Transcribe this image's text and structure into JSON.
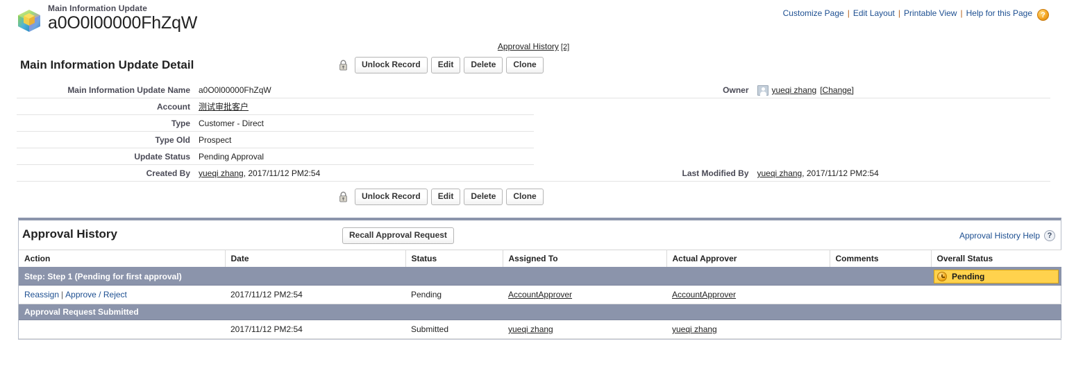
{
  "header": {
    "object_label": "Main Information Update",
    "record_name": "a0O0l00000FhZqW",
    "icon": "custom-cube-icon",
    "links": [
      {
        "label": "Customize Page"
      },
      {
        "label": "Edit Layout"
      },
      {
        "label": "Printable View"
      },
      {
        "label": "Help for this Page"
      }
    ],
    "help_icon": "?",
    "separator": "|"
  },
  "related_nav": {
    "link": "Approval History",
    "count": "[2]"
  },
  "detail": {
    "title": "Main Information Update Detail",
    "lock_icon": "locked-padlock-icon",
    "buttons": [
      {
        "label": "Unlock Record"
      },
      {
        "label": "Edit"
      },
      {
        "label": "Delete"
      },
      {
        "label": "Clone"
      }
    ],
    "fields_left": [
      {
        "label": "Main Information Update Name",
        "value": "a0O0l00000FhZqW",
        "link": false
      },
      {
        "label": "Account",
        "value": "测试审批客户",
        "link": true
      },
      {
        "label": "Type",
        "value": "Customer - Direct",
        "link": false
      },
      {
        "label": "Type Old",
        "value": "Prospect",
        "link": false
      },
      {
        "label": "Update Status",
        "value": "Pending Approval",
        "link": false
      }
    ],
    "created_by": {
      "label": "Created By",
      "user": "yueqi zhang",
      "timestamp": ", 2017/11/12 PM2:54"
    },
    "owner": {
      "label": "Owner",
      "user": "yueqi zhang",
      "change_link": "[Change]",
      "avatar_icon": "user-avatar-icon"
    },
    "last_modified_by": {
      "label": "Last Modified By",
      "user": "yueqi zhang",
      "timestamp": ", 2017/11/12 PM2:54"
    }
  },
  "approval_history": {
    "title": "Approval History",
    "recall_button": "Recall Approval Request",
    "help_link": "Approval History Help",
    "help_icon": "?",
    "columns": [
      "Action",
      "Date",
      "Status",
      "Assigned To",
      "Actual Approver",
      "Comments",
      "Overall Status"
    ],
    "step_row": {
      "label": "Step: Step 1 (Pending for first approval)",
      "overall_status": "Pending",
      "status_icon": "clock-icon",
      "status_color": "#ffd24d"
    },
    "rows": [
      {
        "actions": [
          "Reassign",
          "Approve / Reject"
        ],
        "action_separator": "|",
        "date": "2017/11/12 PM2:54",
        "status": "Pending",
        "assigned_to": "AccountApprover",
        "actual_approver": "AccountApprover",
        "comments": "",
        "overall_status": ""
      }
    ],
    "submitted_row": {
      "label": "Approval Request Submitted"
    },
    "submitted_entry": {
      "actions": [],
      "date": "2017/11/12 PM2:54",
      "status": "Submitted",
      "assigned_to": "yueqi zhang",
      "actual_approver": "yueqi zhang",
      "comments": "",
      "overall_status": ""
    }
  }
}
